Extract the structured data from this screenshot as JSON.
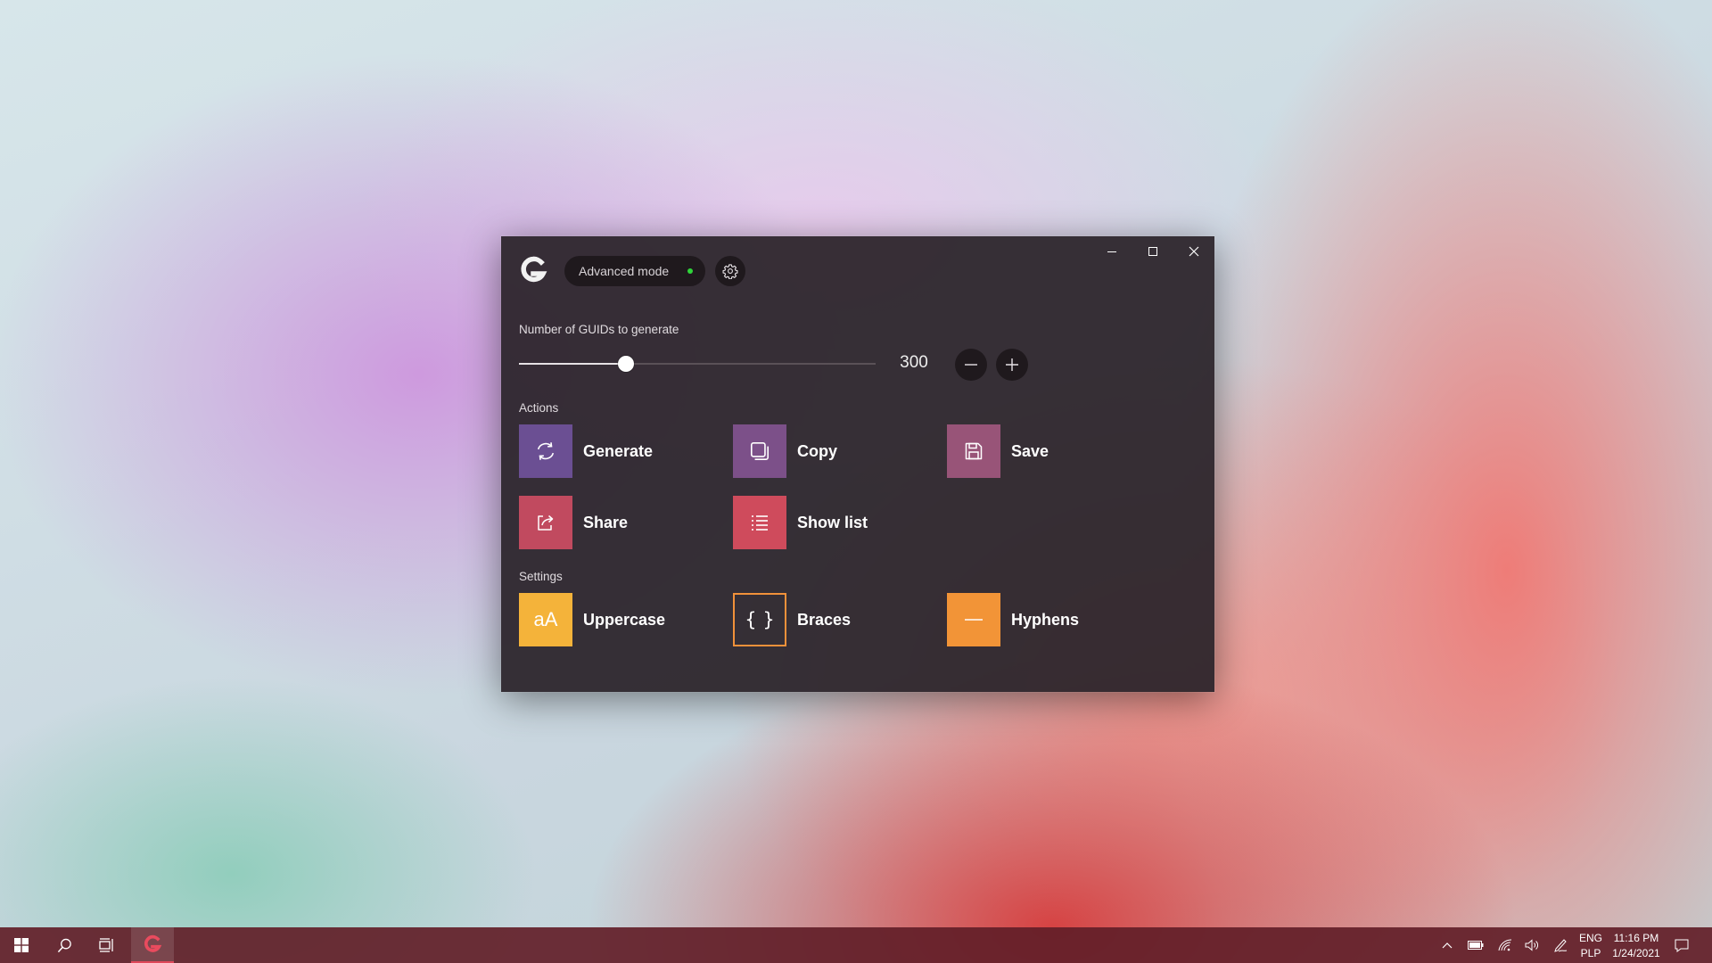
{
  "window": {
    "mode_label": "Advanced mode",
    "mode_indicator_color": "#2fd43a",
    "count_label": "Number of GUIDs to generate",
    "count_value": "300",
    "slider_fraction": 0.3,
    "actions_heading": "Actions",
    "actions": [
      {
        "label": "Generate",
        "icon": "refresh-icon",
        "color": "#6b4f93"
      },
      {
        "label": "Copy",
        "icon": "copy-icon",
        "color": "#7c5089"
      },
      {
        "label": "Save",
        "icon": "save-icon",
        "color": "#985478"
      },
      {
        "label": "Share",
        "icon": "share-icon",
        "color": "#c14a5f"
      },
      {
        "label": "Show list",
        "icon": "list-icon",
        "color": "#cf4b5c"
      }
    ],
    "settings_heading": "Settings",
    "settings": [
      {
        "label": "Uppercase",
        "icon": "text-case-icon",
        "glyph": "aA",
        "color": "#f4b33a",
        "enabled": true
      },
      {
        "label": "Braces",
        "icon": "braces-icon",
        "glyph": "{ }",
        "color": "#f1913a",
        "enabled": false
      },
      {
        "label": "Hyphens",
        "icon": "hyphen-icon",
        "color": "#f29437",
        "enabled": true
      }
    ]
  },
  "taskbar": {
    "language": "ENG",
    "layout": "PLP",
    "time": "11:16 PM",
    "date": "1/24/2021"
  }
}
